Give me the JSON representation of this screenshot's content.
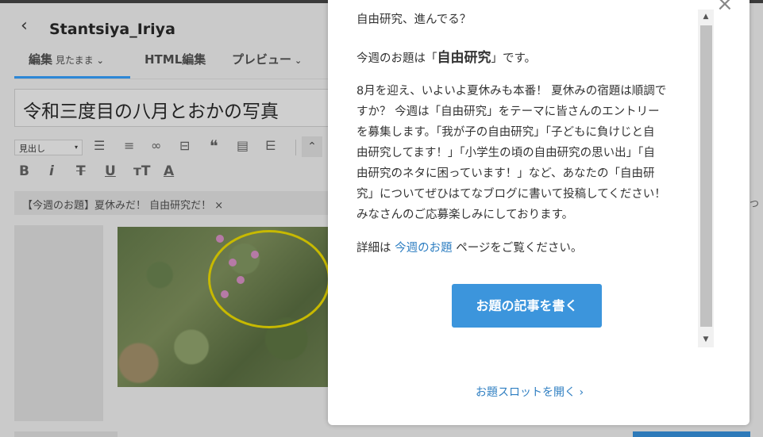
{
  "editor": {
    "back_glyph": "‹",
    "blog_title": "Stantsiya_Iriya",
    "tabs": [
      {
        "label": "編集",
        "sub": "見たまま",
        "chevron": "⌄"
      },
      {
        "label": "HTML編集"
      },
      {
        "label": "プレビュー",
        "chevron": "⌄"
      }
    ],
    "post_title": "令和三度目の八月とおかの写真",
    "format_select": "見出し",
    "format_arrow": "▾",
    "toolbar_icons": [
      "list-bullet-icon",
      "list-ordered-icon",
      "link-icon",
      "horizontal-rule-icon",
      "quote-icon",
      "table-icon",
      "more-icon"
    ],
    "toolbar2": [
      "B",
      "i",
      "T",
      "U",
      "тT",
      "A"
    ],
    "topic_tag": "【今週のお題】夏休みだ！ 自由研究だ！",
    "topic_tag_close": "×",
    "right_edge_text": "つ"
  },
  "modal": {
    "close": "×",
    "greeting": "自由研究、進んでる？",
    "theme_prefix": "今週のお題は「",
    "theme_strong": "自由研究",
    "theme_suffix": "」です。",
    "body": "8月を迎え、いよいよ夏休みも本番！ 夏休みの宿題は順調で\nすか？ 今週は「自由研究」をテーマに皆さんのエントリー\nを募集します。「我が子の自由研究」「子どもに負けじと自\n由研究してます！」「小学生の頃の自由研究の思い出」「自\n由研究のネタに困っています！」など、あなたの「自由研\n究」についてぜひはてなブログに書いて投稿してください！\nみなさんのご応募楽しみにしております。",
    "detail_prefix": "詳細は ",
    "detail_link": "今週のお題",
    "detail_suffix": " ページをご覧ください。",
    "cta": "お題の記事を書く",
    "slot_link": "お題スロットを開く ›",
    "scroll_up": "▲",
    "scroll_down": "▼"
  }
}
